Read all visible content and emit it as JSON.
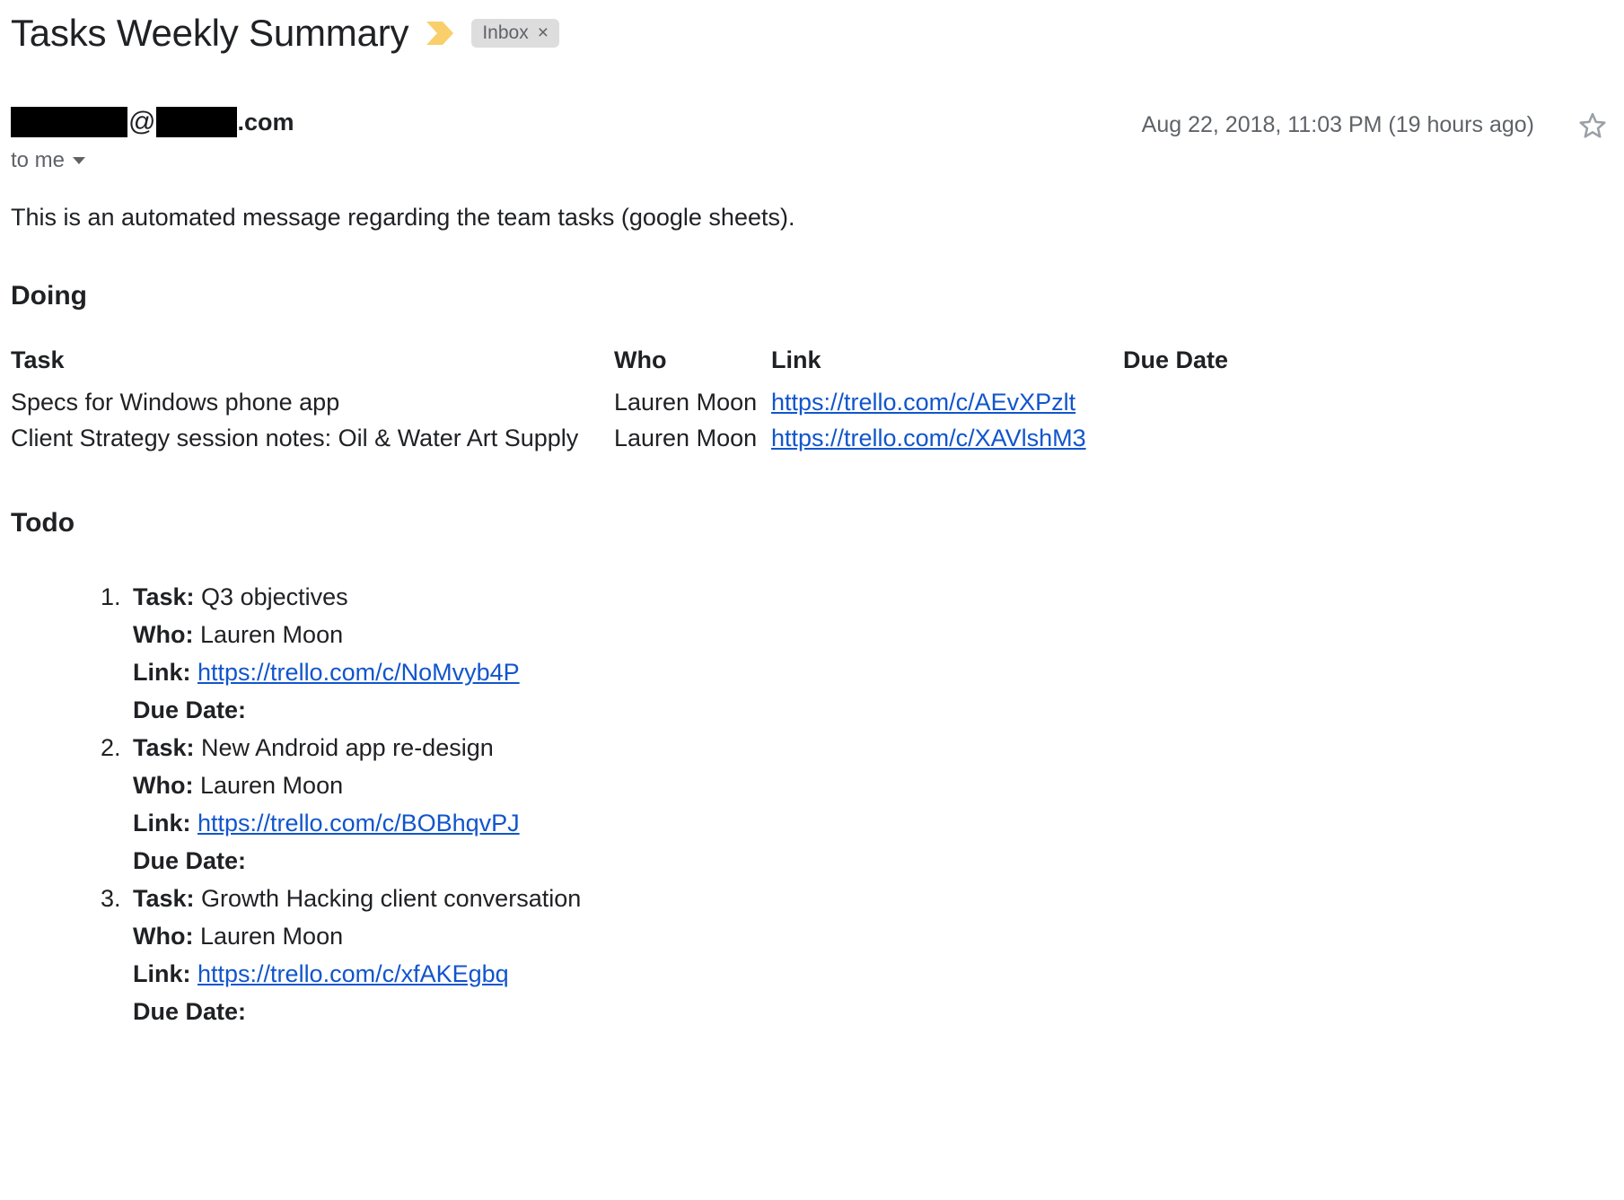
{
  "email": {
    "subject": "Tasks Weekly Summary",
    "important_marker_icon": "important-chevron-icon",
    "label_chip": {
      "text": "Inbox",
      "close": "×"
    },
    "sender": {
      "redacted_user": "",
      "at": "@",
      "redacted_domain": "",
      "tld": ".com"
    },
    "recipients": "to me",
    "timestamp": "Aug 22, 2018, 11:03 PM (19 hours ago)",
    "star_icon": "star-outline-icon",
    "intro": "This is an automated message regarding the team tasks (google sheets)."
  },
  "doing": {
    "heading": "Doing",
    "columns": [
      "Task",
      "Who",
      "Link",
      "Due Date"
    ],
    "rows": [
      {
        "task": "Specs for Windows phone app",
        "who": "Lauren Moon",
        "link": "https://trello.com/c/AEvXPzlt",
        "due_date": ""
      },
      {
        "task": "Client Strategy session notes: Oil & Water Art Supply",
        "who": "Lauren Moon",
        "link": "https://trello.com/c/XAVlshM3",
        "due_date": ""
      }
    ]
  },
  "todo": {
    "heading": "Todo",
    "labels": {
      "task": "Task:",
      "who": "Who:",
      "link": "Link:",
      "due_date": "Due Date:"
    },
    "items": [
      {
        "task": "Q3 objectives",
        "who": "Lauren Moon",
        "link": "https://trello.com/c/NoMvyb4P",
        "due_date": ""
      },
      {
        "task": "New Android app re-design",
        "who": "Lauren Moon",
        "link": "https://trello.com/c/BOBhqvPJ",
        "due_date": ""
      },
      {
        "task": "Growth Hacking client conversation",
        "who": "Lauren Moon",
        "link": "https://trello.com/c/xfAKEgbq",
        "due_date": ""
      }
    ]
  },
  "colors": {
    "important_marker": "#f8cf6b",
    "link": "#1155cc",
    "chip_bg": "#ddddde",
    "muted_text": "#5f6368",
    "text": "#202124"
  }
}
